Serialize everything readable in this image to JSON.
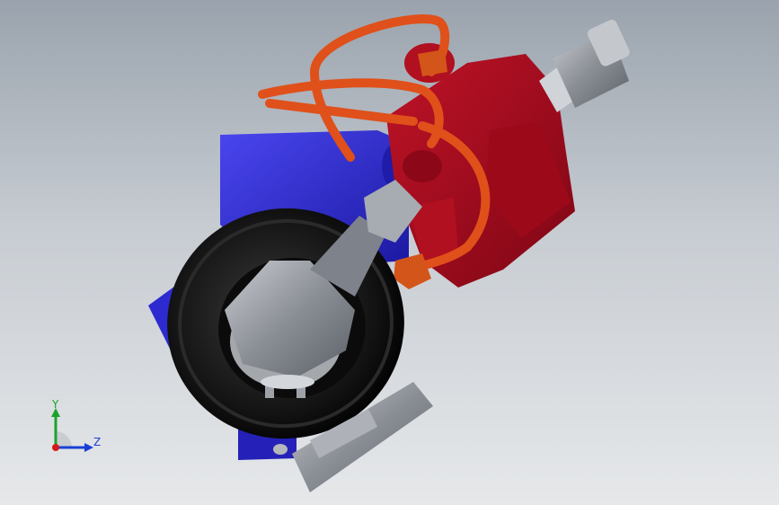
{
  "viewport": {
    "background_top": "#9aa3ad",
    "background_bottom": "#e6e8ea"
  },
  "model": {
    "parts": [
      {
        "name": "blue-bracket",
        "color": "#2d2bd0"
      },
      {
        "name": "red-pump-body",
        "color": "#a00a1a"
      },
      {
        "name": "orange-pipe",
        "color": "#e0501a"
      },
      {
        "name": "tire",
        "color": "#111111"
      },
      {
        "name": "ball-joint",
        "color": "#8a8e95"
      },
      {
        "name": "metal-plate",
        "color": "#9fa3aa"
      },
      {
        "name": "threaded-connector",
        "color": "#b9bcc1"
      }
    ]
  },
  "triad": {
    "y_label": "Y",
    "z_label": "Z",
    "y_color": "#1aa32a",
    "z_color": "#1a3fd6",
    "x_color": "#d61a1a"
  }
}
